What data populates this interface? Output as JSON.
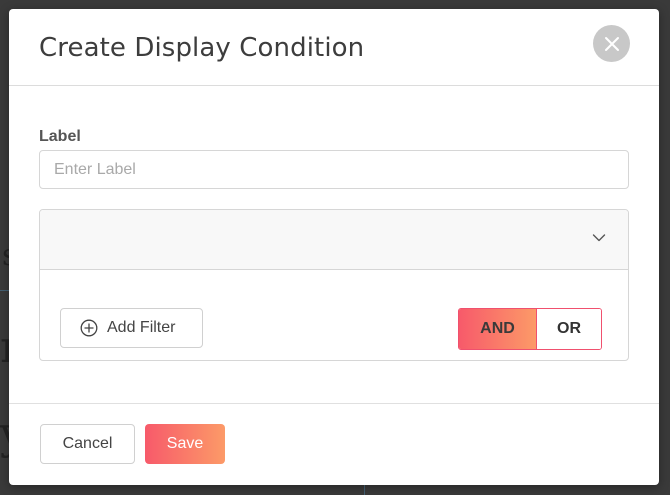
{
  "modal": {
    "title": "Create Display Condition",
    "close_icon": "close-icon"
  },
  "label_field": {
    "label": "Label",
    "value": "",
    "placeholder": "Enter Label"
  },
  "condition_panel": {
    "header_text": "",
    "expand_icon": "chevron-down-icon",
    "add_filter_label": "Add Filter",
    "add_filter_icon": "plus-circle-icon",
    "logic_options": [
      {
        "label": "AND",
        "selected": true
      },
      {
        "label": "OR",
        "selected": false
      }
    ]
  },
  "footer": {
    "cancel_label": "Cancel",
    "save_label": "Save"
  },
  "colors": {
    "accent_start": "#f75a6a",
    "accent_end": "#fc9a68",
    "toggle_border": "#f0506e",
    "close_bg": "#c8c8c8"
  }
}
